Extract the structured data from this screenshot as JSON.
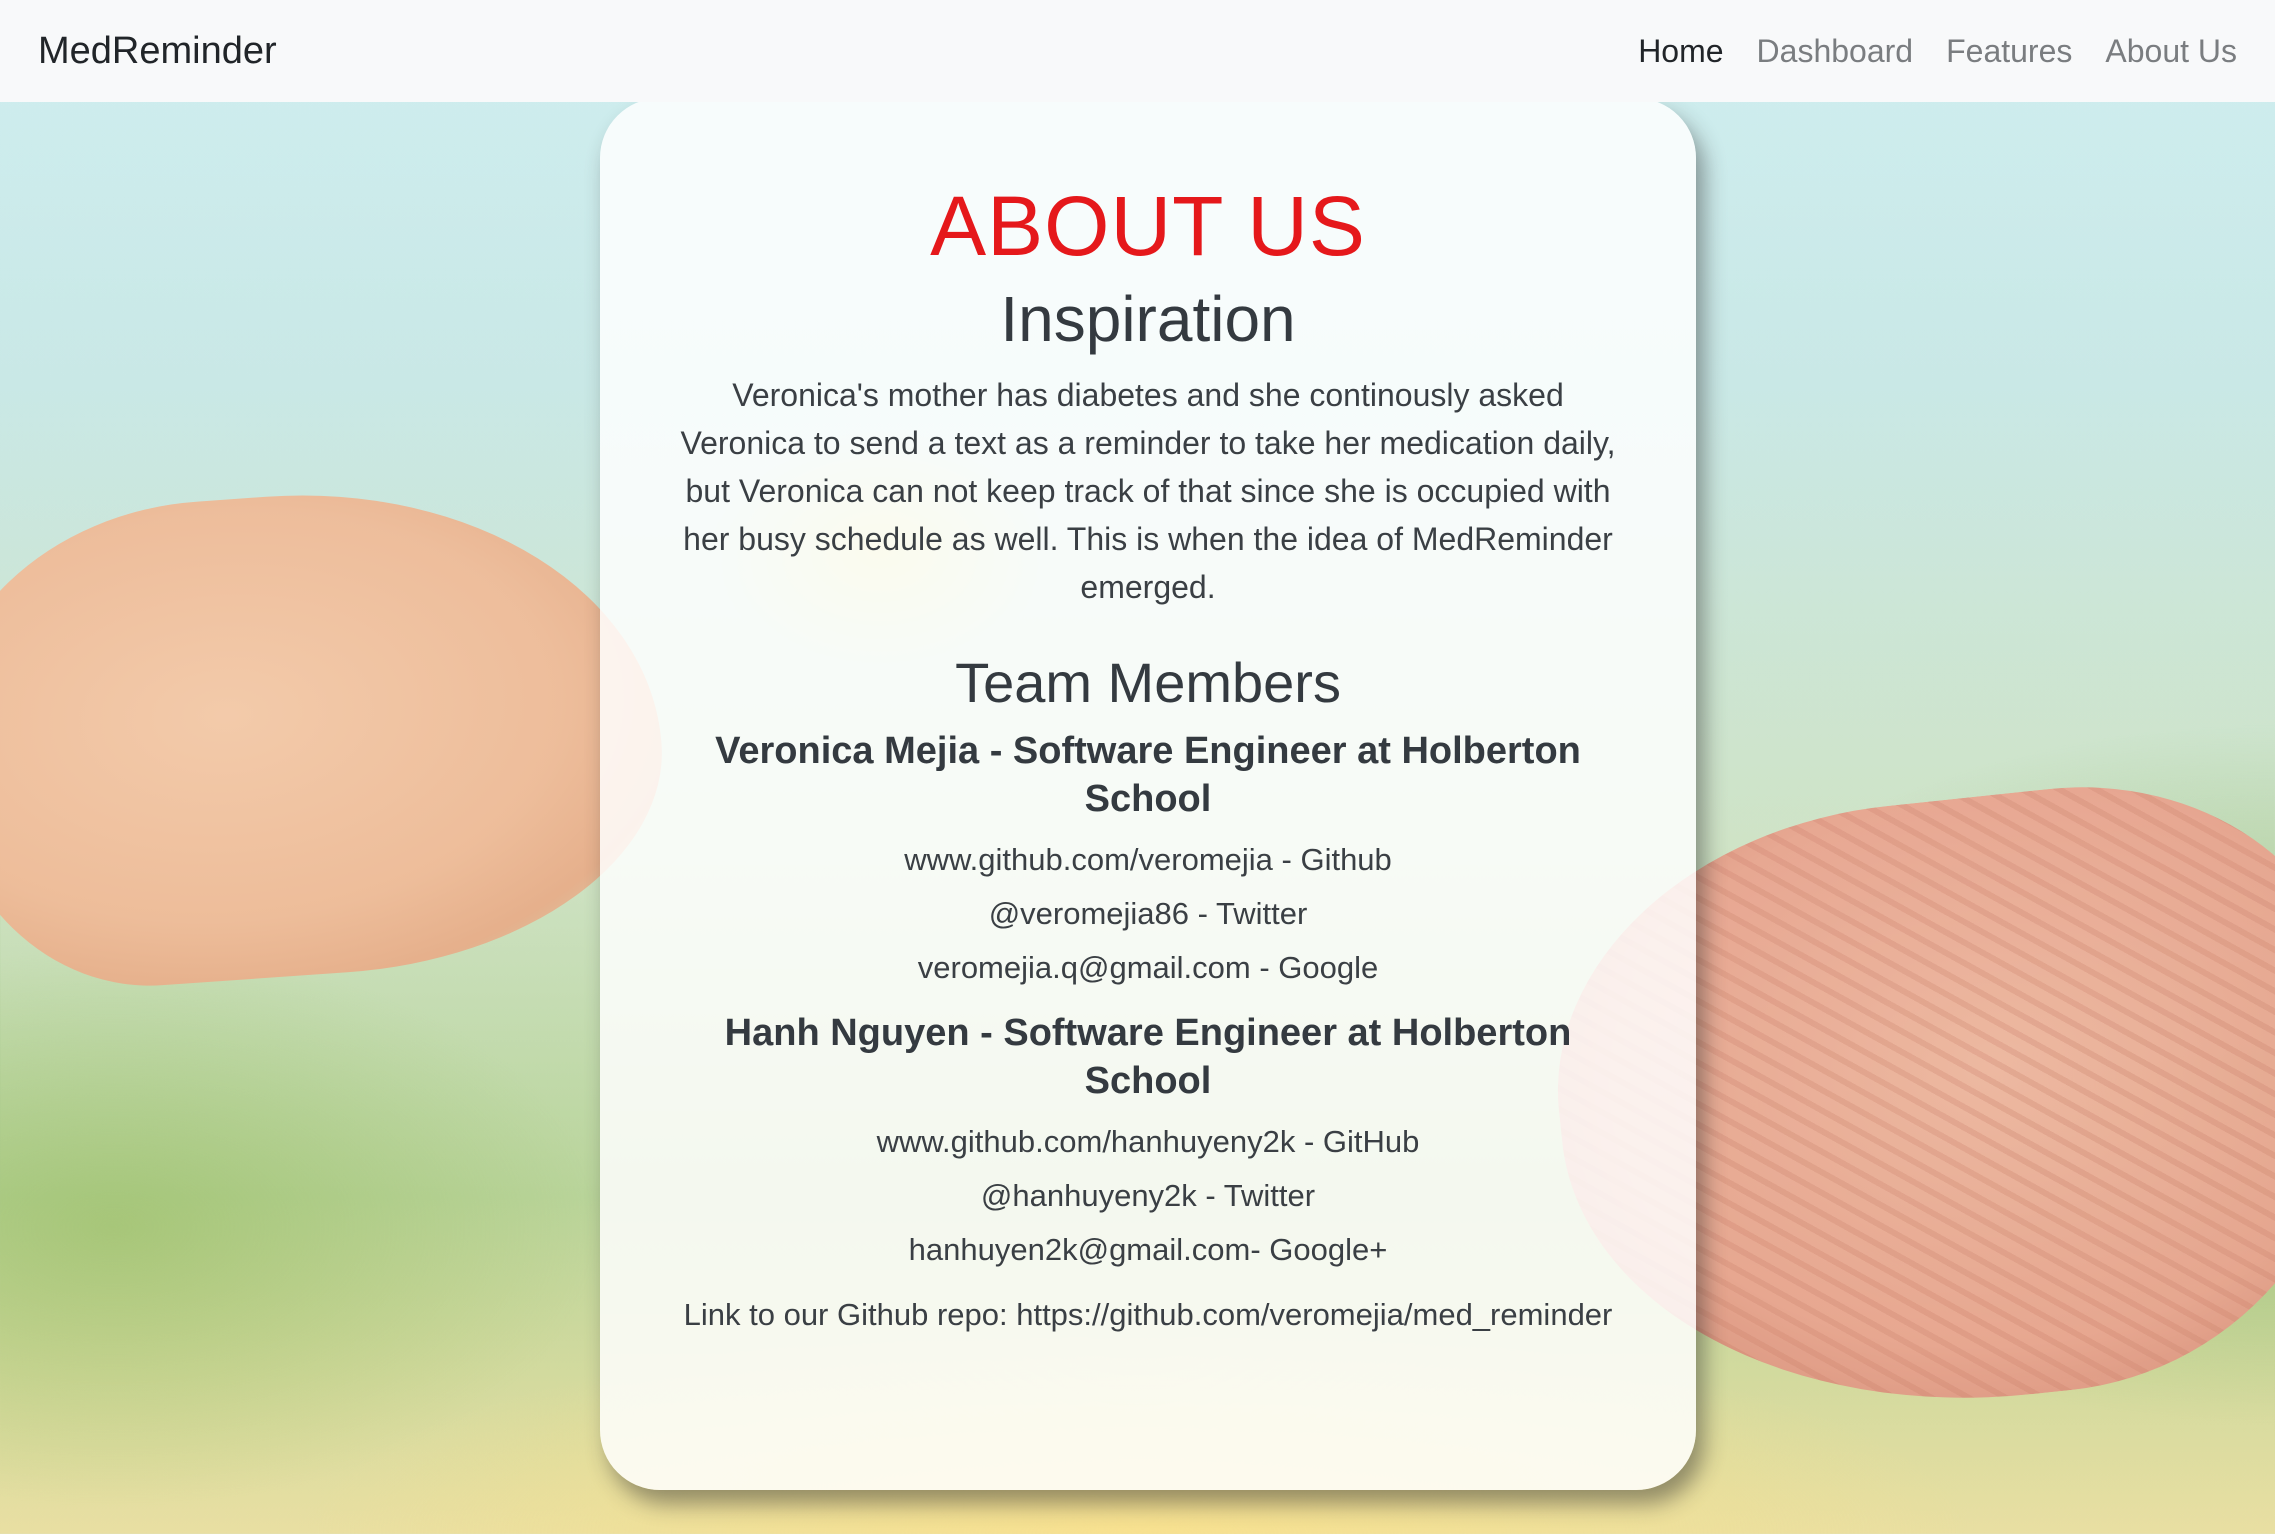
{
  "navbar": {
    "brand": "MedReminder",
    "links": [
      {
        "label": "Home",
        "active": true
      },
      {
        "label": "Dashboard",
        "active": false
      },
      {
        "label": "Features",
        "active": false
      },
      {
        "label": "About Us",
        "active": false
      }
    ]
  },
  "about": {
    "title": "ABOUT US",
    "inspiration_heading": "Inspiration",
    "inspiration_text": "Veronica's mother has diabetes and she continously asked Veronica to send a text as a reminder to take her medication daily, but Veronica can not keep track of that since she is occupied with her busy schedule as well. This is when the idea of MedReminder emerged.",
    "team_heading": "Team Members",
    "members": [
      {
        "name": "Veronica Mejia - Software Engineer at Holberton School",
        "github": "www.github.com/veromejia - Github",
        "twitter": "@veromejia86 - Twitter",
        "google": "veromejia.q@gmail.com - Google"
      },
      {
        "name": "Hanh Nguyen - Software Engineer at Holberton School",
        "github": "www.github.com/hanhuyeny2k - GitHub",
        "twitter": "@hanhuyeny2k - Twitter",
        "google": "hanhuyen2k@gmail.com- Google+"
      }
    ],
    "repo_text": "Link to our Github repo: https://github.com/veromejia/med_reminder"
  },
  "colors": {
    "title": "#e5181b",
    "navbar_bg": "#f8f9fa",
    "text": "#343a40"
  }
}
